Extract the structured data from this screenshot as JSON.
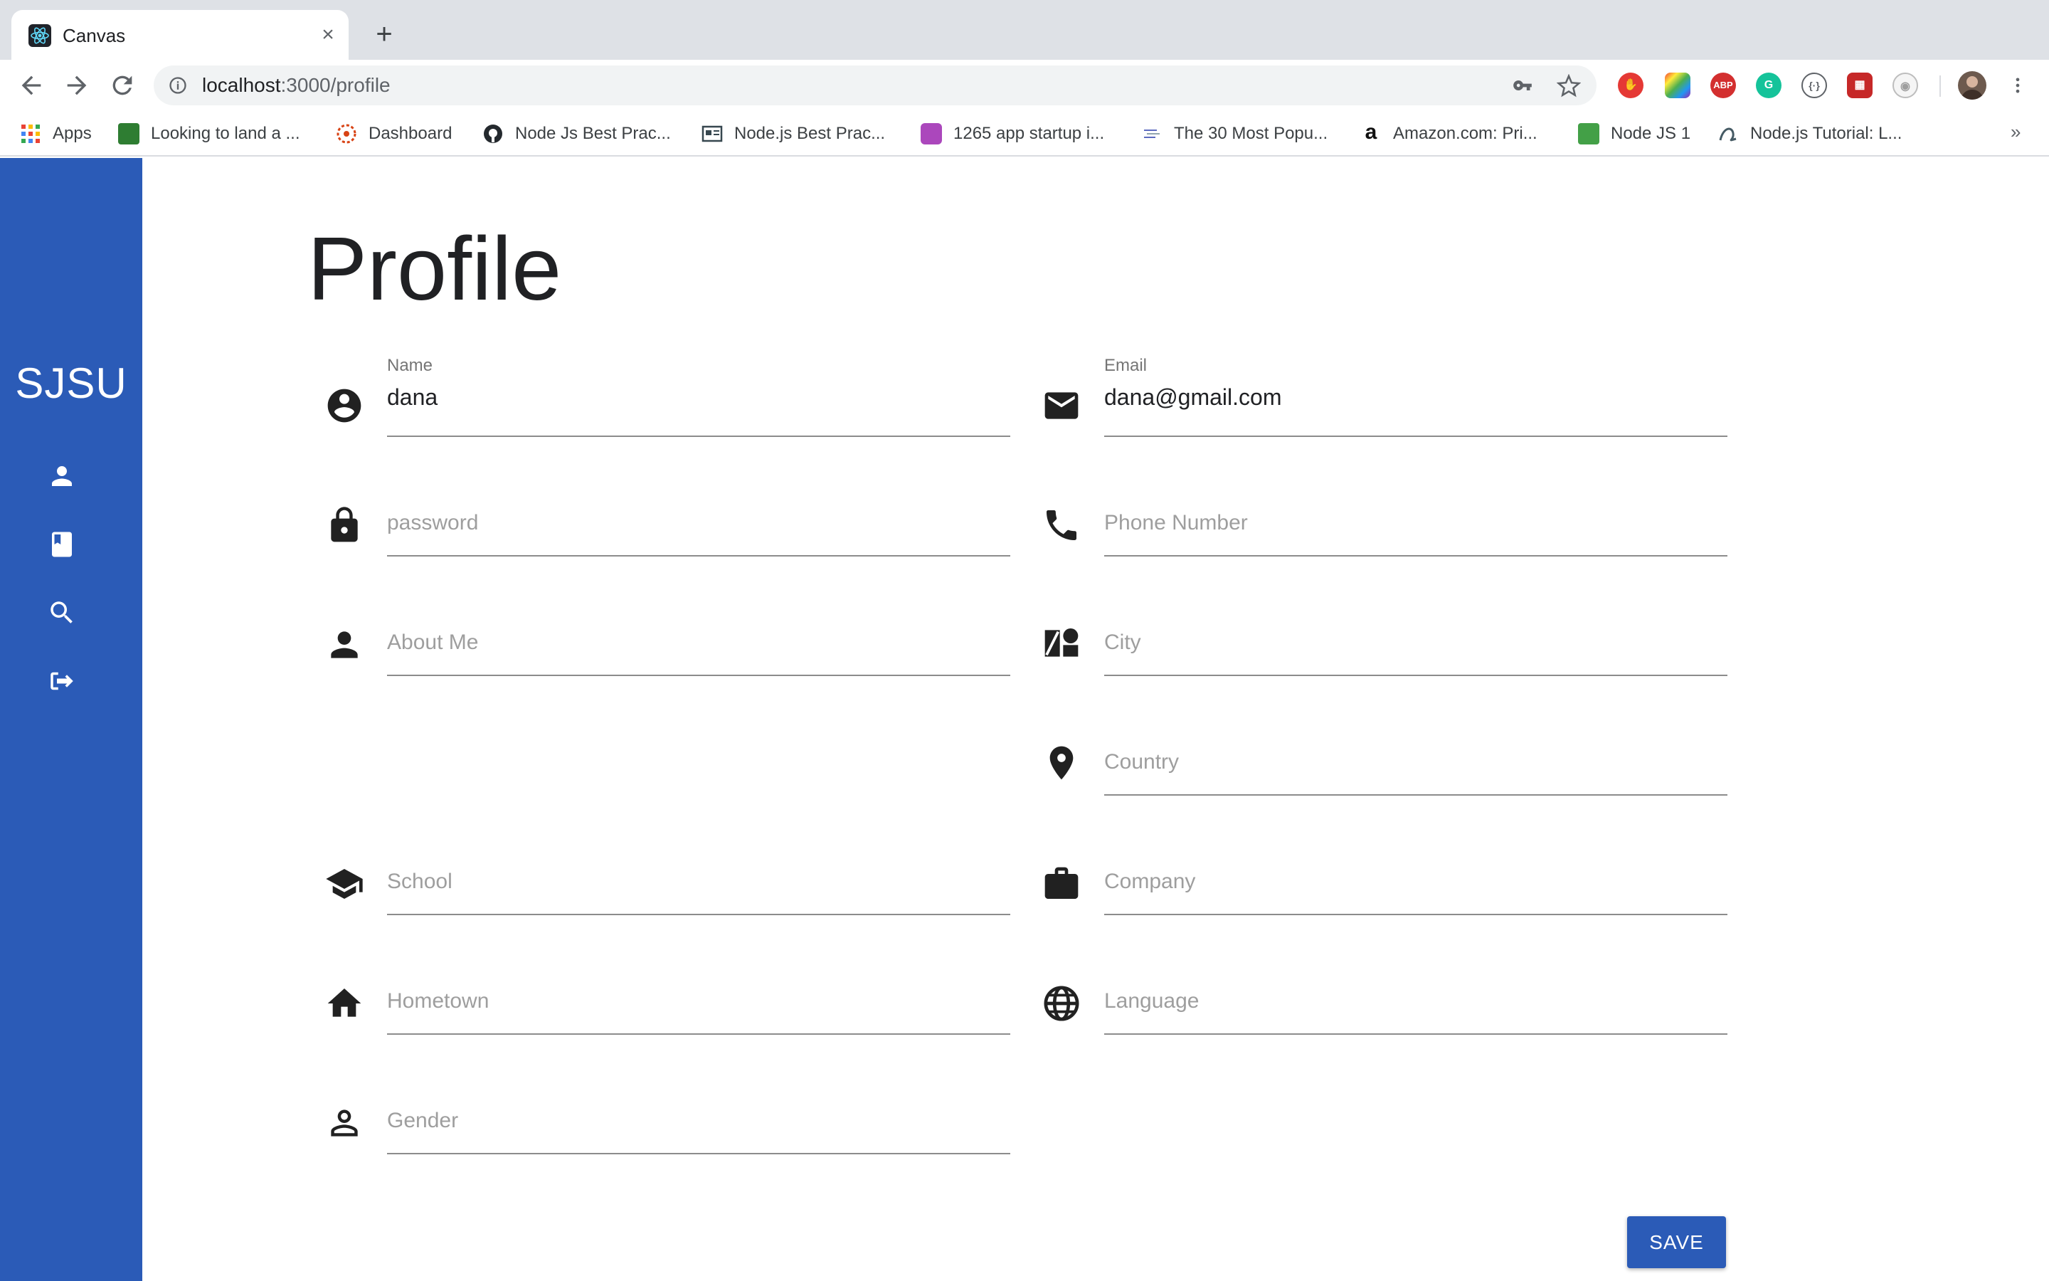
{
  "browser": {
    "tab_title": "Canvas",
    "url_host": "localhost",
    "url_path": ":3000/profile",
    "bookmarks": [
      "Apps",
      "Looking to land a ...",
      "Dashboard",
      "Node Js Best Prac...",
      "Node.js Best Prac...",
      "1265 app startup i...",
      "The 30 Most Popu...",
      "Amazon.com: Pri...",
      "Node JS 1",
      "Node.js Tutorial: L..."
    ],
    "overflow": "»",
    "extensions": [
      "stop-sign-ext",
      "palette-ext",
      "adblock-ext",
      "grammarly-ext",
      "code-ext",
      "photo-ext",
      "panda-ext"
    ],
    "extension_labels": {
      "adblock": "ABP"
    }
  },
  "sidebar": {
    "brand": "SJSU",
    "color": "#2b5bb7",
    "items": [
      "person-icon",
      "book-icon",
      "search-icon",
      "logout-icon"
    ]
  },
  "page": {
    "title": "Profile"
  },
  "form": {
    "name_label": "Name",
    "name_value": "dana",
    "email_label": "Email",
    "email_value": "dana@gmail.com",
    "password_placeholder": "password",
    "phone_placeholder": "Phone Number",
    "about_placeholder": "About Me",
    "city_placeholder": "City",
    "country_placeholder": "Country",
    "school_placeholder": "School",
    "company_placeholder": "Company",
    "hometown_placeholder": "Hometown",
    "language_placeholder": "Language",
    "gender_placeholder": "Gender",
    "save_label": "SAVE"
  }
}
